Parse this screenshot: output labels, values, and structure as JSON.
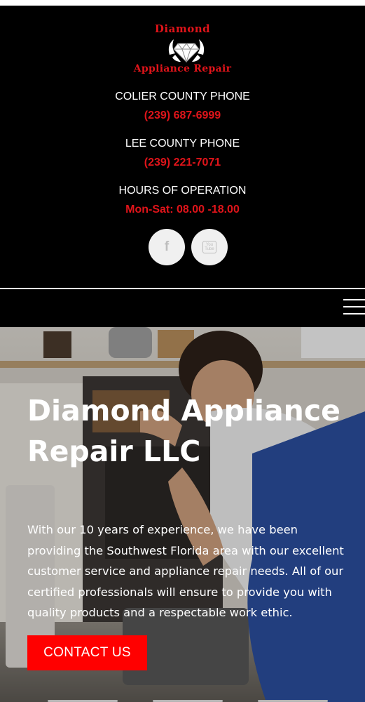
{
  "logo": {
    "line1": "Diamond",
    "line2": "Appliance Repair"
  },
  "contacts": [
    {
      "label": "COLIER COUNTY PHONE",
      "value": "(239) 687-6999"
    },
    {
      "label": "LEE COUNTY PHONE",
      "value": "(239) 221-7071"
    },
    {
      "label": "HOURS OF OPERATION",
      "value": "Mon-Sat: 08.00 -18.00"
    }
  ],
  "social": [
    {
      "icon": "facebook-icon",
      "glyph": "f"
    },
    {
      "icon": "youtube-icon",
      "glyph": "You Tube"
    }
  ],
  "nav": {
    "menu_icon": "hamburger-menu-icon"
  },
  "hero": {
    "title": "Diamond Appliance Repair LLC",
    "text": "With our 10 years of experience, we have been providing the Southwest Florida area with our excellent customer service and appliance repair needs. All of our certified professionals will ensure to provide you with quality products and a respectable work ethic.",
    "cta_label": "CONTACT US"
  },
  "colors": {
    "header_bg": "#000000",
    "accent_red": "#e0141a",
    "cta_red": "#ff0000",
    "text_white": "#ffffff",
    "social_bg": "#f0f0f0"
  }
}
